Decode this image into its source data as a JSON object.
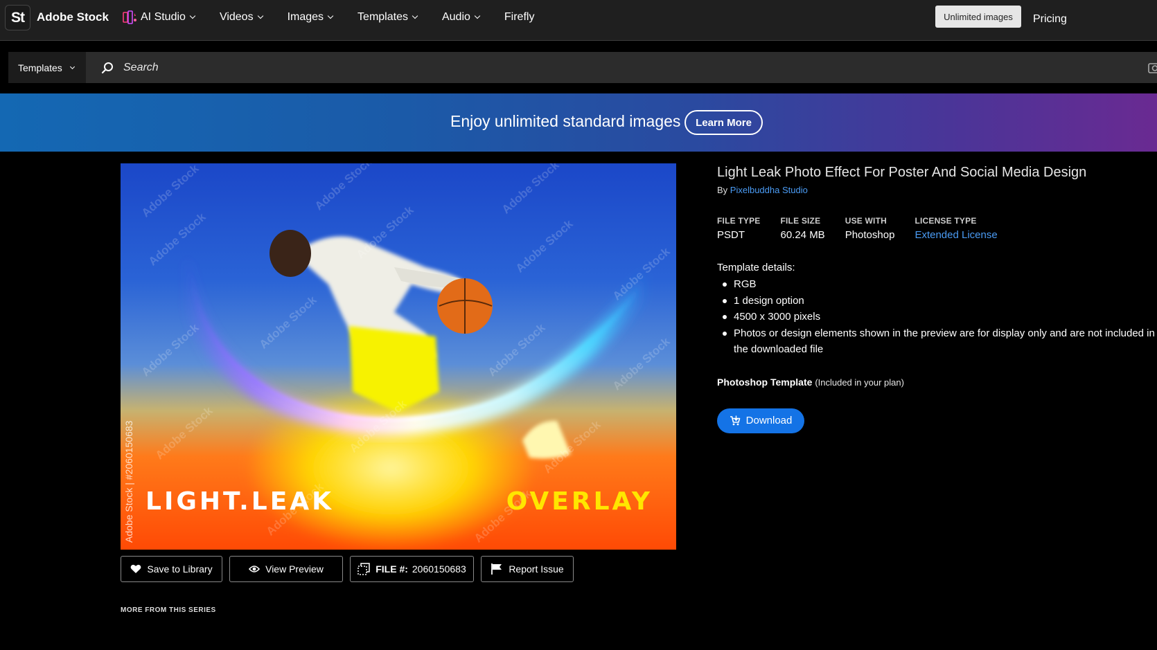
{
  "app": {
    "logo_text": "St",
    "brand": "Adobe Stock"
  },
  "nav": {
    "items": [
      {
        "label": "AI Studio",
        "icon": "ai-studio-icon"
      },
      {
        "label": "Videos"
      },
      {
        "label": "Images"
      },
      {
        "label": "Templates"
      },
      {
        "label": "Audio"
      },
      {
        "label": "Firefly"
      }
    ],
    "unlimited_label": "Unlimited images",
    "pricing_label": "Pricing"
  },
  "search": {
    "scope_label": "Templates",
    "placeholder": "Search"
  },
  "banner": {
    "text": "Enjoy unlimited standard images",
    "button_label": "Learn More"
  },
  "preview": {
    "title_left": "LIGHT.LEAK",
    "title_right": "OVERLAY",
    "vertical_watermark": "Adobe Stock | #2060150683",
    "watermark_text": "Adobe Stock"
  },
  "actions": {
    "save_label": "Save to Library",
    "view_label": "View Preview",
    "file_label": "FILE #:",
    "file_number": "2060150683",
    "report_label": "Report Issue",
    "more_series": "MORE FROM THIS SERIES"
  },
  "details": {
    "title": "Light Leak Photo Effect For Poster And Social Media Design",
    "by_prefix": "By",
    "author": "Pixelbuddha Studio",
    "meta": [
      {
        "label": "FILE TYPE",
        "value": "PSDT"
      },
      {
        "label": "FILE SIZE",
        "value": "60.24 MB"
      },
      {
        "label": "USE WITH",
        "value": "Photoshop"
      },
      {
        "label": "LICENSE TYPE",
        "value": "Extended License"
      }
    ],
    "template_details_title": "Template details:",
    "template_details": [
      "RGB",
      "1 design option",
      "4500 x 3000 pixels",
      "Photos or design elements shown in the preview are for display only and are not included in the downloaded file"
    ],
    "plan_bold": "Photoshop Template",
    "plan_note": "(Included in your plan)",
    "download_label": "Download"
  },
  "colors": {
    "accent": "#1473e6",
    "link": "#4b9cf5"
  }
}
